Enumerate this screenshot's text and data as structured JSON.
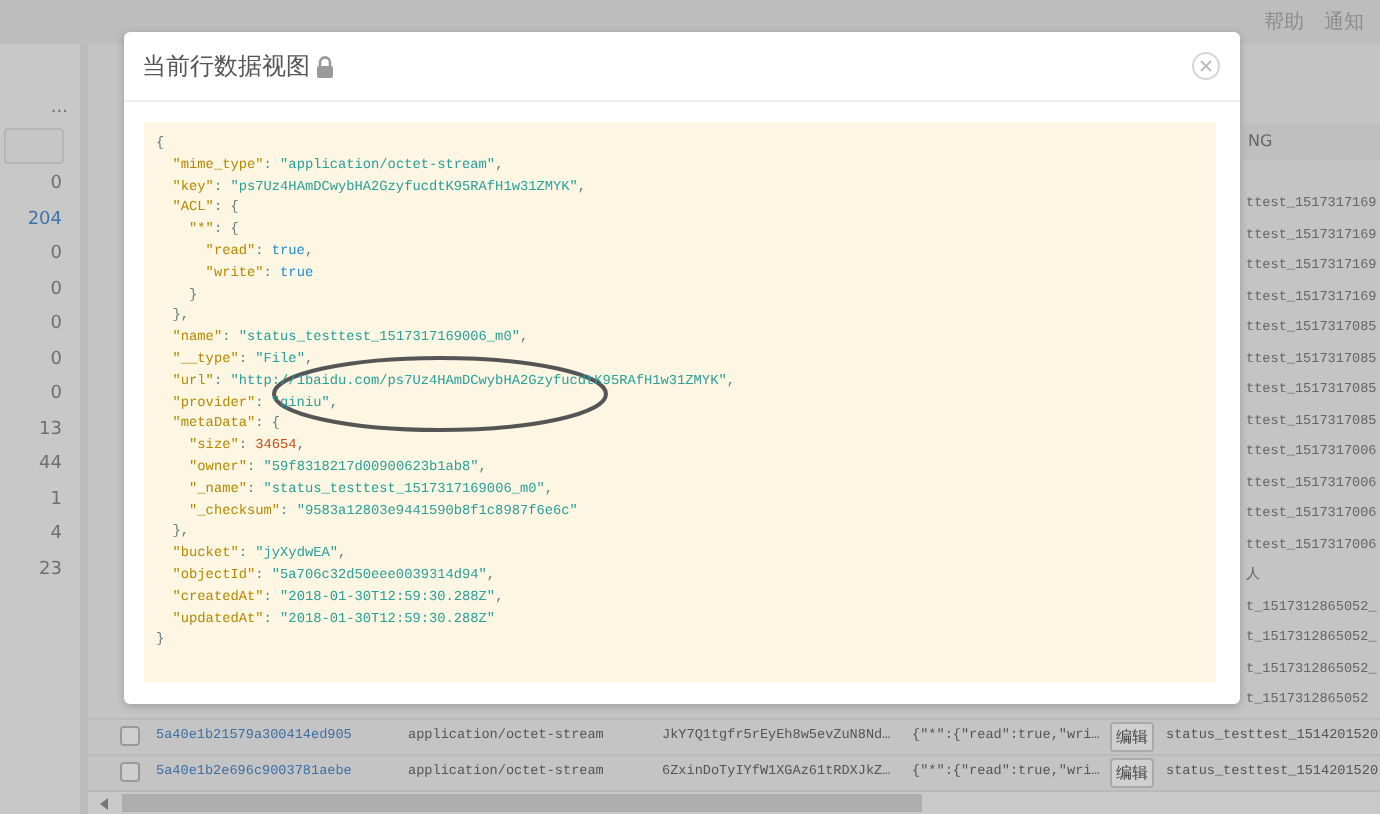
{
  "top_bar": {
    "links": [
      "帮助",
      "通知"
    ]
  },
  "sidebar": {
    "more": "...",
    "counts": [
      {
        "text": "0",
        "highlighted": false
      },
      {
        "text": "204",
        "highlighted": true
      },
      {
        "text": "0",
        "highlighted": false
      },
      {
        "text": "0",
        "highlighted": false
      },
      {
        "text": "0",
        "highlighted": false
      },
      {
        "text": "0",
        "highlighted": false
      },
      {
        "text": "0",
        "highlighted": false
      },
      {
        "text": "13",
        "highlighted": false
      },
      {
        "text": "44",
        "highlighted": false
      },
      {
        "text": "1",
        "highlighted": false
      },
      {
        "text": "4",
        "highlighted": false
      },
      {
        "text": "23",
        "highlighted": false
      }
    ]
  },
  "table": {
    "header_partial": "NG",
    "cut_cells": [
      "ttest_1517317169",
      "ttest_1517317169",
      "ttest_1517317169",
      "ttest_1517317169",
      "ttest_1517317085",
      "ttest_1517317085",
      "ttest_1517317085",
      "ttest_1517317085",
      "ttest_1517317006",
      "ttest_1517317006",
      "ttest_1517317006",
      "ttest_1517317006",
      "人",
      "t_1517312865052_",
      "t_1517312865052_",
      "t_1517312865052_",
      "t_1517312865052"
    ],
    "rows": [
      {
        "checked": false,
        "id": "5a40e1b21579a300414ed905",
        "type": "application/octet-stream",
        "key": "JkY7Q1tgfr5rEyEh8w5evZuN8Nd…",
        "acl": "{\"*\":{\"read\":true,\"wri…",
        "action": "编辑",
        "name": "status_testtest_1514201520"
      },
      {
        "checked": false,
        "id": "5a40e1b2e696c9003781aebe",
        "type": "application/octet-stream",
        "key": "6ZxinDoTyIYfW1XGAz61tRDXJkZ…",
        "acl": "{\"*\":{\"read\":true,\"wri…",
        "action": "编辑",
        "name": "status_testtest_1514201520"
      }
    ]
  },
  "dialog": {
    "title": "当前行数据视图",
    "locked": true,
    "code_lines": [
      [
        {
          "kind": "punct",
          "text": "{"
        }
      ],
      [
        {
          "kind": "key",
          "text": "  \"mime_type\""
        },
        {
          "kind": "punct",
          "text": ": "
        },
        {
          "kind": "string",
          "text": "\"application/octet-stream\""
        },
        {
          "kind": "punct",
          "text": ","
        }
      ],
      [
        {
          "kind": "key",
          "text": "  \"key\""
        },
        {
          "kind": "punct",
          "text": ": "
        },
        {
          "kind": "string",
          "text": "\"ps7Uz4HAmDCwybHA2GzyfucdtK95RAfH1w31ZMYK\""
        },
        {
          "kind": "punct",
          "text": ","
        }
      ],
      [
        {
          "kind": "key",
          "text": "  \"ACL\""
        },
        {
          "kind": "punct",
          "text": ": {"
        }
      ],
      [
        {
          "kind": "key",
          "text": "    \"*\""
        },
        {
          "kind": "punct",
          "text": ": {"
        }
      ],
      [
        {
          "kind": "key",
          "text": "      \"read\""
        },
        {
          "kind": "punct",
          "text": ": "
        },
        {
          "kind": "bool",
          "text": "true"
        },
        {
          "kind": "punct",
          "text": ","
        }
      ],
      [
        {
          "kind": "key",
          "text": "      \"write\""
        },
        {
          "kind": "punct",
          "text": ": "
        },
        {
          "kind": "bool",
          "text": "true"
        }
      ],
      [
        {
          "kind": "punct",
          "text": "    }"
        }
      ],
      [
        {
          "kind": "punct",
          "text": "  },"
        }
      ],
      [
        {
          "kind": "key",
          "text": "  \"name\""
        },
        {
          "kind": "punct",
          "text": ": "
        },
        {
          "kind": "string",
          "text": "\"status_testtest_1517317169006_m0\""
        },
        {
          "kind": "punct",
          "text": ","
        }
      ],
      [
        {
          "kind": "key",
          "text": "  \"__type\""
        },
        {
          "kind": "punct",
          "text": ": "
        },
        {
          "kind": "string",
          "text": "\"File\""
        },
        {
          "kind": "punct",
          "text": ","
        }
      ],
      [
        {
          "kind": "key",
          "text": "  \"url\""
        },
        {
          "kind": "punct",
          "text": ": "
        },
        {
          "kind": "string",
          "text": "\"http://1baidu.com/ps7Uz4HAmDCwybHA2GzyfucdtK95RAfH1w31ZMYK\""
        },
        {
          "kind": "punct",
          "text": ","
        }
      ],
      [
        {
          "kind": "key",
          "text": "  \"provider\""
        },
        {
          "kind": "punct",
          "text": ": "
        },
        {
          "kind": "string",
          "text": "\"qiniu\""
        },
        {
          "kind": "punct",
          "text": ","
        }
      ],
      [
        {
          "kind": "key",
          "text": "  \"metaData\""
        },
        {
          "kind": "punct",
          "text": ": {"
        }
      ],
      [
        {
          "kind": "key",
          "text": "    \"size\""
        },
        {
          "kind": "punct",
          "text": ": "
        },
        {
          "kind": "number",
          "text": "34654"
        },
        {
          "kind": "punct",
          "text": ","
        }
      ],
      [
        {
          "kind": "key",
          "text": "    \"owner\""
        },
        {
          "kind": "punct",
          "text": ": "
        },
        {
          "kind": "string",
          "text": "\"59f8318217d00900623b1ab8\""
        },
        {
          "kind": "punct",
          "text": ","
        }
      ],
      [
        {
          "kind": "key",
          "text": "    \"_name\""
        },
        {
          "kind": "punct",
          "text": ": "
        },
        {
          "kind": "string",
          "text": "\"status_testtest_1517317169006_m0\""
        },
        {
          "kind": "punct",
          "text": ","
        }
      ],
      [
        {
          "kind": "key",
          "text": "    \"_checksum\""
        },
        {
          "kind": "punct",
          "text": ": "
        },
        {
          "kind": "string",
          "text": "\"9583a12803e9441590b8f1c8987f6e6c\""
        }
      ],
      [
        {
          "kind": "punct",
          "text": "  },"
        }
      ],
      [
        {
          "kind": "key",
          "text": "  \"bucket\""
        },
        {
          "kind": "punct",
          "text": ": "
        },
        {
          "kind": "string",
          "text": "\"jyXydwEA\""
        },
        {
          "kind": "punct",
          "text": ","
        }
      ],
      [
        {
          "kind": "key",
          "text": "  \"objectId\""
        },
        {
          "kind": "punct",
          "text": ": "
        },
        {
          "kind": "string",
          "text": "\"5a706c32d50eee0039314d94\""
        },
        {
          "kind": "punct",
          "text": ","
        }
      ],
      [
        {
          "kind": "key",
          "text": "  \"createdAt\""
        },
        {
          "kind": "punct",
          "text": ": "
        },
        {
          "kind": "string",
          "text": "\"2018-01-30T12:59:30.288Z\""
        },
        {
          "kind": "punct",
          "text": ","
        }
      ],
      [
        {
          "kind": "key",
          "text": "  \"updatedAt\""
        },
        {
          "kind": "punct",
          "text": ": "
        },
        {
          "kind": "string",
          "text": "\"2018-01-30T12:59:30.288Z\""
        }
      ],
      [
        {
          "kind": "punct",
          "text": "}"
        }
      ]
    ]
  }
}
